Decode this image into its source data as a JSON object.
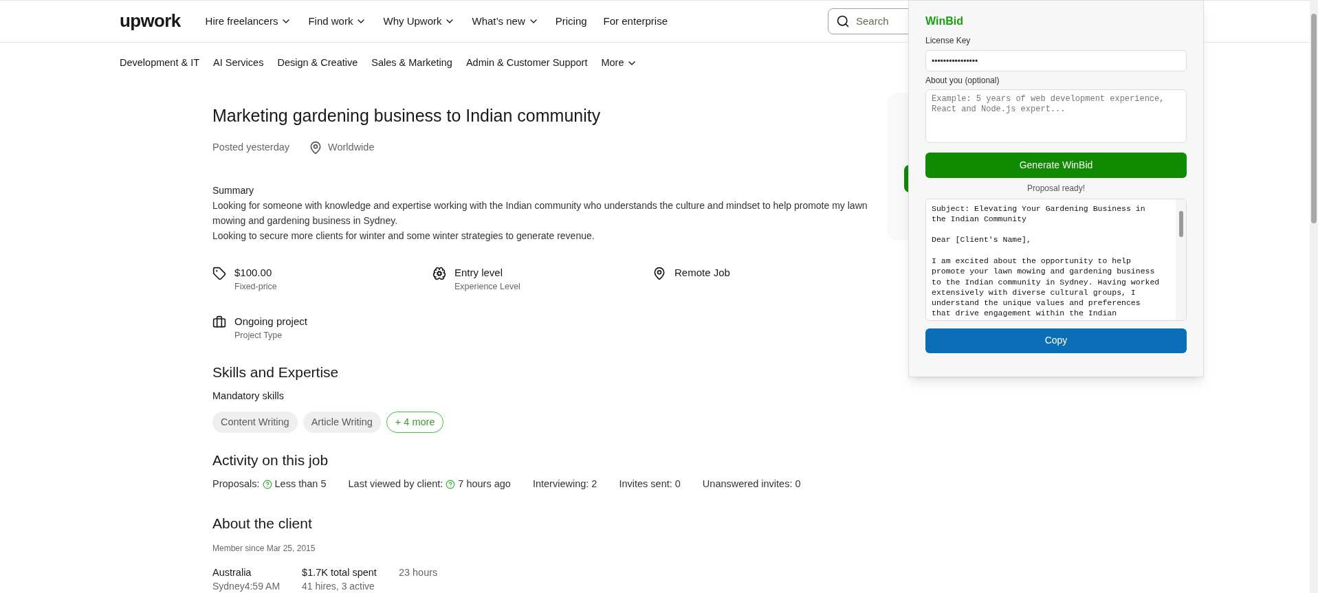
{
  "header": {
    "logo": "upwork",
    "nav": [
      {
        "label": "Hire freelancers",
        "dropdown": true
      },
      {
        "label": "Find work",
        "dropdown": true
      },
      {
        "label": "Why Upwork",
        "dropdown": true
      },
      {
        "label": "What’s new",
        "dropdown": true
      },
      {
        "label": "Pricing",
        "dropdown": false
      },
      {
        "label": "For enterprise",
        "dropdown": false
      }
    ],
    "search": {
      "placeholder": "Search"
    }
  },
  "categories": [
    {
      "label": "Development & IT",
      "dropdown": false
    },
    {
      "label": "AI Services",
      "dropdown": false
    },
    {
      "label": "Design & Creative",
      "dropdown": false
    },
    {
      "label": "Sales & Marketing",
      "dropdown": false
    },
    {
      "label": "Admin & Customer Support",
      "dropdown": false
    },
    {
      "label": "More",
      "dropdown": true
    }
  ],
  "job": {
    "title": "Marketing gardening business to Indian community",
    "posted": "Posted yesterday",
    "location": "Worldwide",
    "summary_heading": "Summary",
    "summary": [
      "Looking for someone with knowledge and expertise working with the Indian community who understands the culture and mindset to help promote my lawn mowing and gardening business in Sydney.",
      "Looking to secure more clients for winter and some winter strategies to generate revenue."
    ],
    "facts": [
      {
        "kind": "tag",
        "value": "$100.00",
        "caption": "Fixed-price"
      },
      {
        "kind": "brain",
        "value": "Entry level",
        "caption": "Experience Level"
      },
      {
        "kind": "pin",
        "value": "Remote Job"
      },
      {
        "kind": "briefcase",
        "value": "Ongoing project",
        "caption": "Project Type"
      }
    ],
    "skills_heading": "Skills and Expertise",
    "skills_subheading": "Mandatory skills",
    "skills": [
      {
        "kind": "skill",
        "label": "Content Writing"
      },
      {
        "kind": "skill",
        "label": "Article Writing"
      },
      {
        "kind": "more",
        "label": "+ 4 more"
      }
    ],
    "activity_heading": "Activity on this job",
    "activity": [
      {
        "label": "Proposals:",
        "value": "Less than 5",
        "help": true
      },
      {
        "label": "Last viewed by client:",
        "value": "7 hours ago",
        "help": true
      },
      {
        "label": "Interviewing:",
        "value": "2",
        "help": false
      },
      {
        "label": "Invites sent:",
        "value": "0",
        "help": false
      },
      {
        "label": "Unanswered invites:",
        "value": "0",
        "help": false
      }
    ],
    "client_heading": "About the client",
    "member_since": "Member since Mar 25, 2015",
    "client_stats": [
      {
        "main": "Australia",
        "sub": "Sydney4:59 AM",
        "strong": true
      },
      {
        "main": "$1.7K total spent",
        "sub": "41 hires, 3 active",
        "strong": true
      },
      {
        "main": "23 hours",
        "strong": false
      }
    ]
  },
  "popup": {
    "title": "WinBid",
    "license_label": "License Key",
    "license_value": "••••••••••••••••",
    "about_label": "About you (optional)",
    "about_placeholder": "Example: 5 years of web development experience,\nReact and Node.js expert...",
    "generate_button": "Generate WinBid",
    "status": "Proposal ready!",
    "proposal": "Subject: Elevating Your Gardening Business in\nthe Indian Community\n\nDear [Client's Name],\n\nI am excited about the opportunity to help\npromote your lawn mowing and gardening business\nto the Indian community in Sydney. Having worked\nextensively with diverse cultural groups, I\nunderstand the unique values and preferences\nthat drive engagement within the Indian",
    "copy_button": "Copy"
  }
}
